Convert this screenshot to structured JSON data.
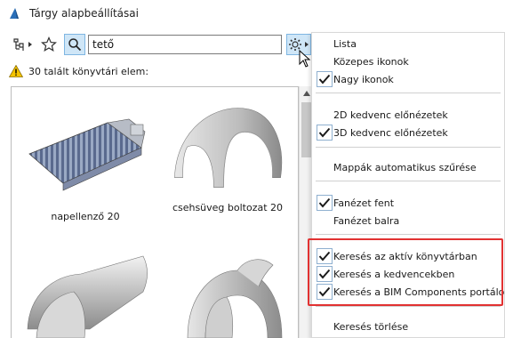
{
  "window": {
    "title": "Tárgy alapbeállításai"
  },
  "toolbar": {
    "search_value": "tető"
  },
  "results": {
    "text": "30 talált könyvtári elem:"
  },
  "gallery": {
    "items": [
      {
        "label": "napellenző 20"
      },
      {
        "label": "csehsüveg boltozat 20"
      },
      {
        "label": ""
      },
      {
        "label": ""
      }
    ]
  },
  "menu": {
    "items": [
      {
        "label": "Lista",
        "checked": false
      },
      {
        "label": "Közepes ikonok",
        "checked": false
      },
      {
        "label": "Nagy ikonok",
        "checked": true
      },
      {
        "label": "2D kedvenc előnézetek",
        "checked": false
      },
      {
        "label": "3D kedvenc előnézetek",
        "checked": true
      },
      {
        "label": "Mappák automatikus szűrése",
        "checked": false
      },
      {
        "label": "Fanézet fent",
        "checked": true
      },
      {
        "label": "Fanézet balra",
        "checked": false
      },
      {
        "label": "Keresés az aktív könyvtárban",
        "checked": true
      },
      {
        "label": "Keresés a kedvencekben",
        "checked": true
      },
      {
        "label": "Keresés a BIM Components portálon",
        "checked": true
      },
      {
        "label": "Keresés törlése",
        "checked": false
      }
    ]
  },
  "colors": {
    "accent": "#cfe6f7",
    "highlight": "#e23232",
    "check": "#1a1a1a",
    "warning": "#f5c400"
  }
}
